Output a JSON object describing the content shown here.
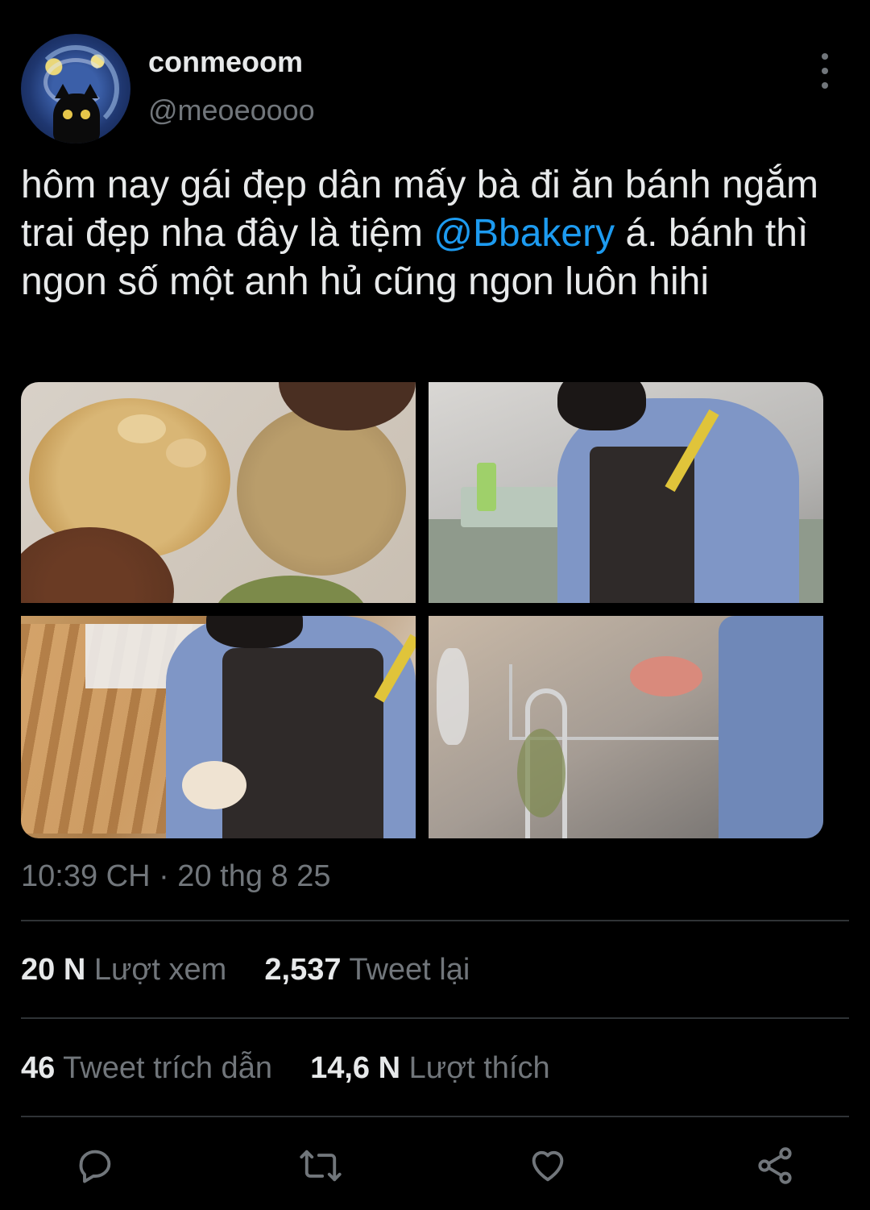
{
  "author": {
    "display_name": "conmeoom",
    "handle": "@meoeoooo"
  },
  "tweet": {
    "text_before": "hôm nay gái đẹp dân mấy bà đi ăn bánh ngắm trai đẹp nha đây là tiệm ",
    "mention": "@Bbakery",
    "text_after": " á. bánh thì ngon số một anh hủ cũng ngon luôn hihi"
  },
  "media": [
    "cookies-photo",
    "baker-cutting-photo",
    "baker-cupcake-photo",
    "kitchen-sink-photo"
  ],
  "timestamp": "10:39 CH · 20 thg 8 25",
  "stats": {
    "views_count": "20 N",
    "views_label": "Lượt xem",
    "retweets_count": "2,537",
    "retweets_label": "Tweet lại",
    "quotes_count": "46",
    "quotes_label": "Tweet trích dẫn",
    "likes_count": "14,6 N",
    "likes_label": "Lượt thích"
  },
  "actions": [
    "reply-icon",
    "retweet-icon",
    "like-icon",
    "share-icon"
  ],
  "colors": {
    "background": "#000000",
    "text": "#e7e9ea",
    "muted": "#71767b",
    "link": "#1d9bf0",
    "divider": "#2f3336"
  }
}
